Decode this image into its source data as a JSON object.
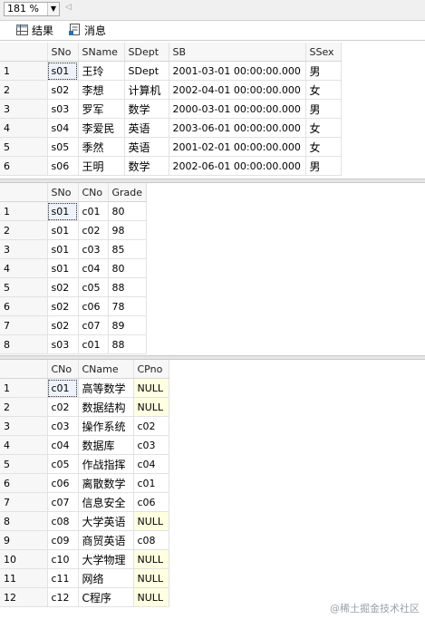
{
  "toolbar": {
    "zoom": "181 %",
    "scroll_left": "◁"
  },
  "tabs": [
    {
      "label": "结果"
    },
    {
      "label": "消息"
    }
  ],
  "grid1": {
    "columns": [
      "SNo",
      "SName",
      "SDept",
      "SB",
      "SSex"
    ],
    "rows": [
      [
        "1",
        "s01",
        "王玲",
        "SDept",
        "2001-03-01 00:00:00.000",
        "男"
      ],
      [
        "2",
        "s02",
        "李想",
        "计算机",
        "2002-04-01 00:00:00.000",
        "女"
      ],
      [
        "3",
        "s03",
        "罗军",
        "数学",
        "2000-03-01 00:00:00.000",
        "男"
      ],
      [
        "4",
        "s04",
        "李爱民",
        "英语",
        "2003-06-01 00:00:00.000",
        "女"
      ],
      [
        "5",
        "s05",
        "季然",
        "英语",
        "2001-02-01 00:00:00.000",
        "女"
      ],
      [
        "6",
        "s06",
        "王明",
        "数学",
        "2002-06-01 00:00:00.000",
        "男"
      ]
    ]
  },
  "grid2": {
    "columns": [
      "SNo",
      "CNo",
      "Grade"
    ],
    "rows": [
      [
        "1",
        "s01",
        "c01",
        "80"
      ],
      [
        "2",
        "s01",
        "c02",
        "98"
      ],
      [
        "3",
        "s01",
        "c03",
        "85"
      ],
      [
        "4",
        "s01",
        "c04",
        "80"
      ],
      [
        "5",
        "s02",
        "c05",
        "88"
      ],
      [
        "6",
        "s02",
        "c06",
        "78"
      ],
      [
        "7",
        "s02",
        "c07",
        "89"
      ],
      [
        "8",
        "s03",
        "c01",
        "88"
      ]
    ]
  },
  "grid3": {
    "columns": [
      "CNo",
      "CName",
      "CPno"
    ],
    "rows": [
      [
        "1",
        "c01",
        "高等数学",
        "NULL"
      ],
      [
        "2",
        "c02",
        "数据结构",
        "NULL"
      ],
      [
        "3",
        "c03",
        "操作系统",
        "c02"
      ],
      [
        "4",
        "c04",
        "数据库",
        "c03"
      ],
      [
        "5",
        "c05",
        "作战指挥",
        "c04"
      ],
      [
        "6",
        "c06",
        "离散数学",
        "c01"
      ],
      [
        "7",
        "c07",
        "信息安全",
        "c06"
      ],
      [
        "8",
        "c08",
        "大学英语",
        "NULL"
      ],
      [
        "9",
        "c09",
        "商贸英语",
        "c08"
      ],
      [
        "10",
        "c10",
        "大学物理",
        "NULL"
      ],
      [
        "11",
        "c11",
        "网络",
        "NULL"
      ],
      [
        "12",
        "c12",
        "C程序",
        "NULL"
      ]
    ]
  },
  "watermark": "@稀土掘金技术社区",
  "colors": {
    "null_bg": "#ffffe1",
    "header_bg": "#f7f7f7",
    "grid_line": "#e2e2e2"
  }
}
